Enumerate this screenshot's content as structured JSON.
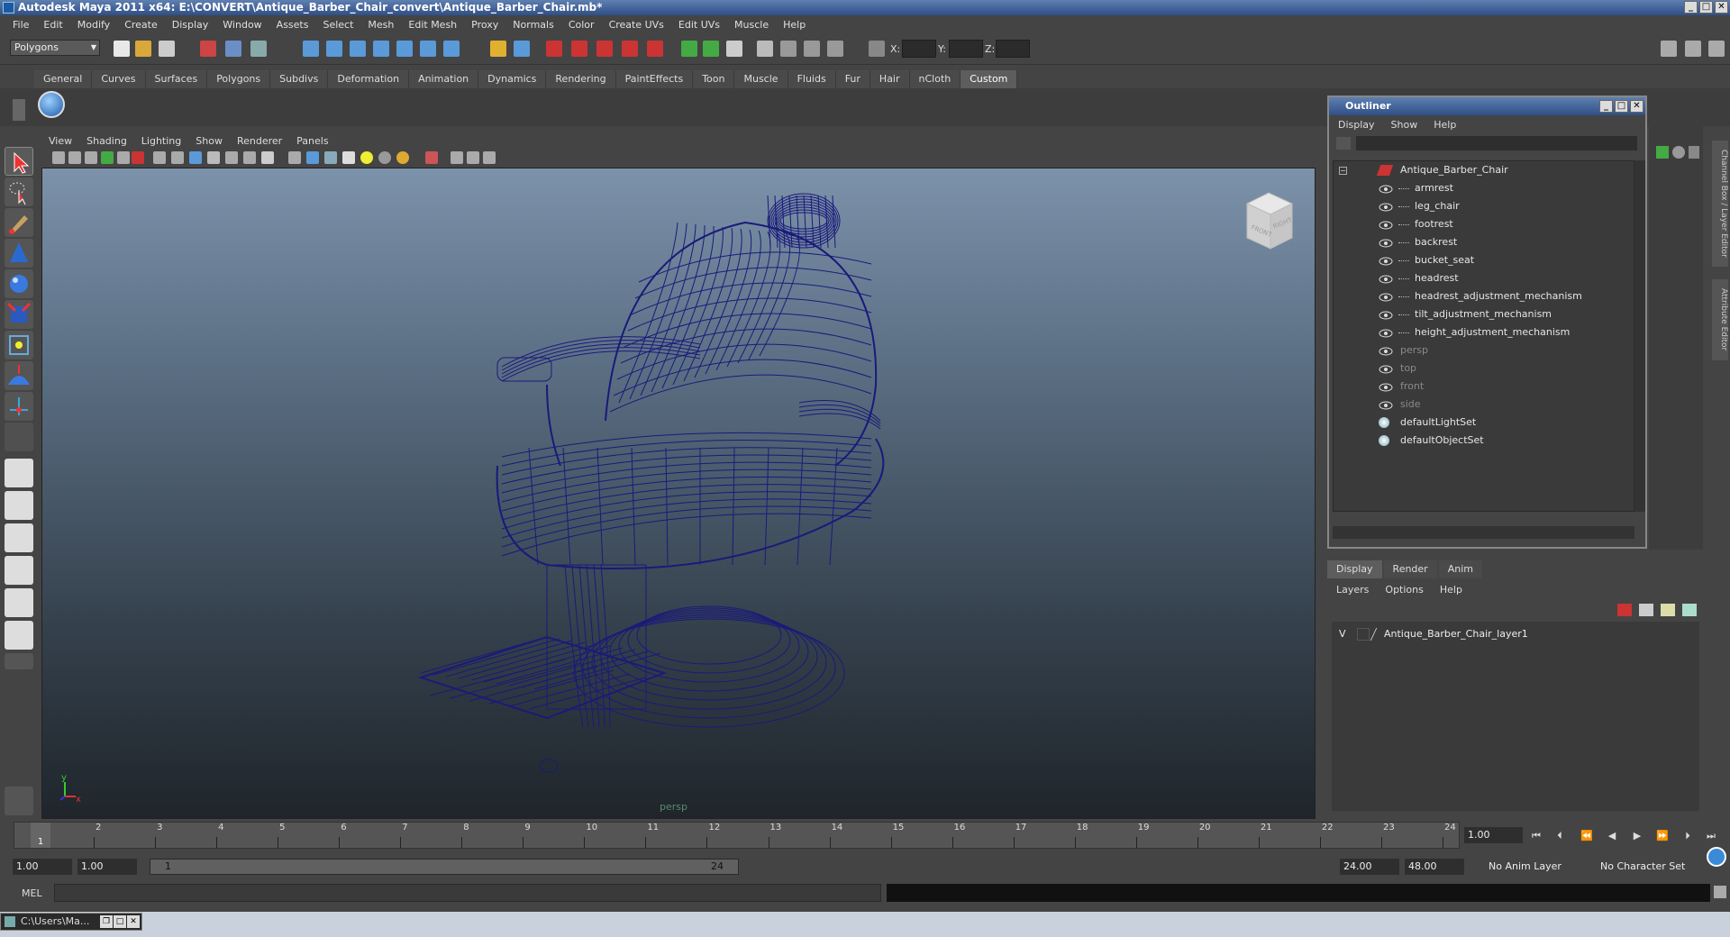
{
  "window": {
    "title": "Autodesk Maya 2011 x64: E:\\CONVERT\\Antique_Barber_Chair_convert\\Antique_Barber_Chair.mb*",
    "controls": [
      "_",
      "□",
      "✕"
    ]
  },
  "menubar": [
    "File",
    "Edit",
    "Modify",
    "Create",
    "Display",
    "Window",
    "Assets",
    "Select",
    "Mesh",
    "Edit Mesh",
    "Proxy",
    "Normals",
    "Color",
    "Create UVs",
    "Edit UVs",
    "Muscle",
    "Help"
  ],
  "status": {
    "mode": "Polygons",
    "x_label": "X:",
    "y_label": "Y:",
    "z_label": "Z:"
  },
  "shelf": {
    "tabs": [
      "General",
      "Curves",
      "Surfaces",
      "Polygons",
      "Subdivs",
      "Deformation",
      "Animation",
      "Dynamics",
      "Rendering",
      "PaintEffects",
      "Toon",
      "Muscle",
      "Fluids",
      "Fur",
      "Hair",
      "nCloth",
      "Custom"
    ],
    "active": "Custom"
  },
  "viewport": {
    "menu": [
      "View",
      "Shading",
      "Lighting",
      "Show",
      "Renderer",
      "Panels"
    ],
    "camera": "persp",
    "cube_front": "FRONT",
    "cube_right": "RIGHT",
    "axis_x": "x",
    "axis_y": "y",
    "wire_color": "#1a1a7a"
  },
  "outliner": {
    "title": "Outliner",
    "menu": [
      "Display",
      "Show",
      "Help"
    ],
    "root": "Antique_Barber_Chair",
    "children": [
      "armrest",
      "leg_chair",
      "footrest",
      "backrest",
      "bucket_seat",
      "headrest",
      "headrest_adjustment_mechanism",
      "tilt_adjustment_mechanism",
      "height_adjustment_mechanism"
    ],
    "cameras": [
      "persp",
      "top",
      "front",
      "side"
    ],
    "sets": [
      "defaultLightSet",
      "defaultObjectSet"
    ]
  },
  "right_tabs": {
    "channel": "Channel Box / Layer Editor",
    "attribute": "Attribute Editor"
  },
  "layers": {
    "tabs": [
      "Display",
      "Render",
      "Anim"
    ],
    "active": "Display",
    "menu": [
      "Layers",
      "Options",
      "Help"
    ],
    "visible_flag": "V",
    "layer_name": "Antique_Barber_Chair_layer1"
  },
  "timeline": {
    "ticks": [
      "1",
      "2",
      "3",
      "4",
      "5",
      "6",
      "7",
      "8",
      "9",
      "10",
      "11",
      "12",
      "13",
      "14",
      "15",
      "16",
      "17",
      "18",
      "19",
      "20",
      "21",
      "22",
      "23",
      "24"
    ],
    "current_marker": "1",
    "current_frame": "1.00"
  },
  "range": {
    "start": "1.00",
    "playback_start": "1.00",
    "slider_start": "1",
    "slider_end": "24",
    "playback_end": "24.00",
    "end": "48.00",
    "anim_layer": "No Anim Layer",
    "char_set": "No Character Set"
  },
  "command": {
    "label": "MEL"
  },
  "taskbar": {
    "label": "C:\\Users\\Ma..."
  }
}
